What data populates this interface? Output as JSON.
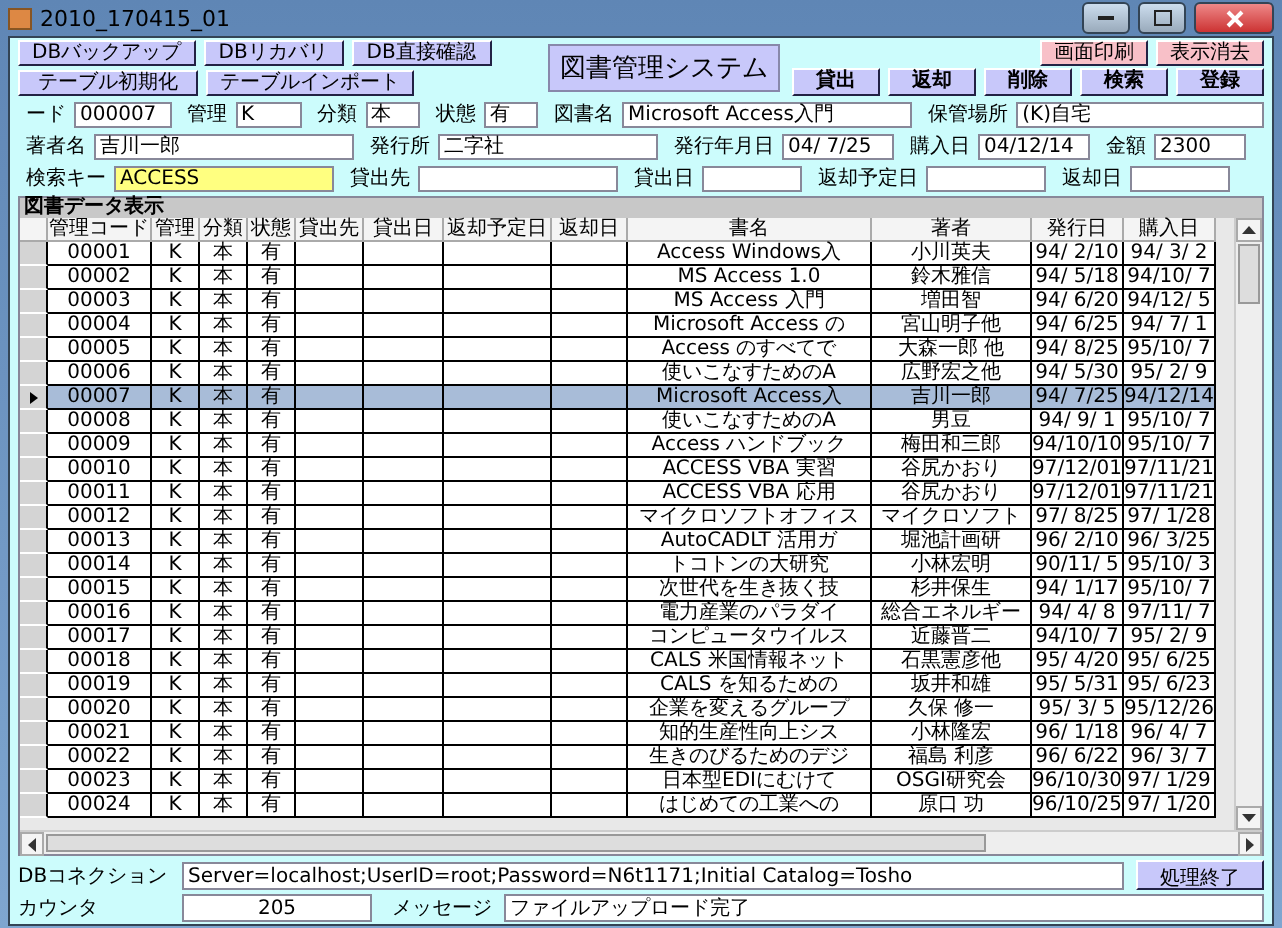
{
  "window": {
    "title": "2010_170415_01"
  },
  "db_buttons": [
    {
      "label": "DBバックアップ"
    },
    {
      "label": "DBリカバリ"
    },
    {
      "label": "DB直接確認"
    }
  ],
  "table_buttons": [
    {
      "label": "テーブル初期化"
    },
    {
      "label": "テーブルインポート"
    }
  ],
  "app_title": "図書管理システム",
  "utility_buttons": [
    {
      "label": "画面印刷"
    },
    {
      "label": "表示消去"
    }
  ],
  "action_buttons": [
    {
      "label": "貸出"
    },
    {
      "label": "返却"
    },
    {
      "label": "削除"
    },
    {
      "label": "検索"
    },
    {
      "label": "登録"
    }
  ],
  "form_rows": [
    {
      "fields": [
        {
          "label": "ード",
          "value": "000007",
          "highlighted": false
        },
        {
          "label": "管理",
          "value": "K",
          "highlighted": false
        },
        {
          "label": "分類",
          "value": "本",
          "highlighted": false
        },
        {
          "label": "状態",
          "value": "有",
          "highlighted": false
        },
        {
          "label": "図書名",
          "value": "Microsoft Access入門",
          "highlighted": false
        },
        {
          "label": "保管場所",
          "value": "(K)自宅",
          "highlighted": false
        }
      ]
    },
    {
      "fields": [
        {
          "label": "著者名",
          "value": "吉川一郎",
          "highlighted": false
        },
        {
          "label": "発行所",
          "value": "二字社",
          "highlighted": false
        },
        {
          "label": "発行年月日",
          "value": "04/ 7/25",
          "highlighted": false
        },
        {
          "label": "購入日",
          "value": "04/12/14",
          "highlighted": false
        },
        {
          "label": "金額",
          "value": "2300",
          "highlighted": false
        }
      ]
    },
    {
      "fields": [
        {
          "label": "検索キー",
          "value": "ACCESS",
          "highlighted": true
        },
        {
          "label": "貸出先",
          "highlighted": false
        },
        {
          "label": "貸出日",
          "highlighted": false
        },
        {
          "label": "返却予定日",
          "highlighted": false
        },
        {
          "label": "返却日",
          "highlighted": false
        }
      ]
    }
  ],
  "grid": {
    "caption": "図書データ表示",
    "columns": [
      "管理コード",
      "管理",
      "分類",
      "状態",
      "貸出先",
      "貸出日",
      "返却予定日",
      "返却日",
      "書名",
      "著者",
      "発行日",
      "購入日"
    ],
    "rows": [
      {
        "code": "00001",
        "management": "K",
        "category": "本",
        "status": "有",
        "title": "Access Windows入",
        "author": "小川英夫",
        "issued": "94/ 2/10",
        "purchased": "94/ 3/ 2",
        "selected": false
      },
      {
        "code": "00002",
        "management": "K",
        "category": "本",
        "status": "有",
        "title": "MS Access 1.0",
        "author": "鈴木雅信",
        "issued": "94/ 5/18",
        "purchased": "94/10/ 7",
        "selected": false
      },
      {
        "code": "00003",
        "management": "K",
        "category": "本",
        "status": "有",
        "title": "MS Access 入門",
        "author": "増田智",
        "issued": "94/ 6/20",
        "purchased": "94/12/ 5",
        "selected": false
      },
      {
        "code": "00004",
        "management": "K",
        "category": "本",
        "status": "有",
        "title": "Microsoft Access の",
        "author": "宮山明子他",
        "issued": "94/ 6/25",
        "purchased": "94/ 7/ 1",
        "selected": false
      },
      {
        "code": "00005",
        "management": "K",
        "category": "本",
        "status": "有",
        "title": "Access のすべてで",
        "author": "大森一郎 他",
        "issued": "94/ 8/25",
        "purchased": "95/10/ 7",
        "selected": false
      },
      {
        "code": "00006",
        "management": "K",
        "category": "本",
        "status": "有",
        "title": "使いこなすためのA",
        "author": "広野宏之他",
        "issued": "94/ 5/30",
        "purchased": "95/ 2/ 9",
        "selected": false
      },
      {
        "code": "00007",
        "management": "K",
        "category": "本",
        "status": "有",
        "title": "Microsoft Access入",
        "author": "吉川一郎",
        "issued": "94/ 7/25",
        "purchased": "94/12/14",
        "selected": true
      },
      {
        "code": "00008",
        "management": "K",
        "category": "本",
        "status": "有",
        "title": "使いこなすためのA",
        "author": "男豆",
        "issued": "94/ 9/ 1",
        "purchased": "95/10/ 7",
        "selected": false
      },
      {
        "code": "00009",
        "management": "K",
        "category": "本",
        "status": "有",
        "title": "Access ハンドブック",
        "author": "梅田和三郎",
        "issued": "94/10/10",
        "purchased": "95/10/ 7",
        "selected": false
      },
      {
        "code": "00010",
        "management": "K",
        "category": "本",
        "status": "有",
        "title": "ACCESS VBA 実習",
        "author": "谷尻かおり",
        "issued": "97/12/01",
        "purchased": "97/11/21",
        "selected": false
      },
      {
        "code": "00011",
        "management": "K",
        "category": "本",
        "status": "有",
        "title": "ACCESS VBA 応用",
        "author": "谷尻かおり",
        "issued": "97/12/01",
        "purchased": "97/11/21",
        "selected": false
      },
      {
        "code": "00012",
        "management": "K",
        "category": "本",
        "status": "有",
        "title": "マイクロソフトオフィス",
        "author": "マイクロソフト",
        "issued": "97/ 8/25",
        "purchased": "97/ 1/28",
        "selected": false
      },
      {
        "code": "00013",
        "management": "K",
        "category": "本",
        "status": "有",
        "title": "AutoCADLT 活用ガ",
        "author": "堀池計画研",
        "issued": "96/ 2/10",
        "purchased": "96/ 3/25",
        "selected": false
      },
      {
        "code": "00014",
        "management": "K",
        "category": "本",
        "status": "有",
        "title": "トコトンの大研究",
        "author": "小林宏明",
        "issued": "90/11/ 5",
        "purchased": "95/10/ 3",
        "selected": false
      },
      {
        "code": "00015",
        "management": "K",
        "category": "本",
        "status": "有",
        "title": "次世代を生き抜く技",
        "author": "杉井保生",
        "issued": "94/ 1/17",
        "purchased": "95/10/ 7",
        "selected": false
      },
      {
        "code": "00016",
        "management": "K",
        "category": "本",
        "status": "有",
        "title": "電力産業のパラダイ",
        "author": "総合エネルギー",
        "issued": "94/ 4/ 8",
        "purchased": "97/11/ 7",
        "selected": false
      },
      {
        "code": "00017",
        "management": "K",
        "category": "本",
        "status": "有",
        "title": "コンピュータウイルス",
        "author": "近藤晋二",
        "issued": "94/10/ 7",
        "purchased": "95/ 2/ 9",
        "selected": false
      },
      {
        "code": "00018",
        "management": "K",
        "category": "本",
        "status": "有",
        "title": "CALS 米国情報ネット",
        "author": "石黒憲彦他",
        "issued": "95/ 4/20",
        "purchased": "95/ 6/25",
        "selected": false
      },
      {
        "code": "00019",
        "management": "K",
        "category": "本",
        "status": "有",
        "title": "CALS を知るための",
        "author": "坂井和雄",
        "issued": "95/ 5/31",
        "purchased": "95/ 6/23",
        "selected": false
      },
      {
        "code": "00020",
        "management": "K",
        "category": "本",
        "status": "有",
        "title": "企業を変えるグループ",
        "author": "久保 修一",
        "issued": "95/ 3/ 5",
        "purchased": "95/12/26",
        "selected": false
      },
      {
        "code": "00021",
        "management": "K",
        "category": "本",
        "status": "有",
        "title": "知的生産性向上シス",
        "author": "小林隆宏",
        "issued": "96/ 1/18",
        "purchased": "96/ 4/ 7",
        "selected": false
      },
      {
        "code": "00022",
        "management": "K",
        "category": "本",
        "status": "有",
        "title": "生きのびるためのデジ",
        "author": "福島 利彦",
        "issued": "96/ 6/22",
        "purchased": "96/ 3/ 7",
        "selected": false
      },
      {
        "code": "00023",
        "management": "K",
        "category": "本",
        "status": "有",
        "title": "日本型EDIにむけて",
        "author": "OSGI研究会",
        "issued": "96/10/30",
        "purchased": "97/ 1/29",
        "selected": false
      },
      {
        "code": "00024",
        "management": "K",
        "category": "本",
        "status": "有",
        "title": "はじめての工業への",
        "author": "原口 功",
        "issued": "96/10/25",
        "purchased": "97/ 1/20",
        "selected": false
      }
    ]
  },
  "connection": {
    "label": "DBコネクション",
    "value": "Server=localhost;UserID=root;Password=N6t1171;Initial Catalog=Tosho"
  },
  "finish_button": "処理終了",
  "counter": {
    "label": "カウンタ",
    "value": "205"
  },
  "message": {
    "label": "メッセージ",
    "value": "ファイルアップロード完了"
  }
}
